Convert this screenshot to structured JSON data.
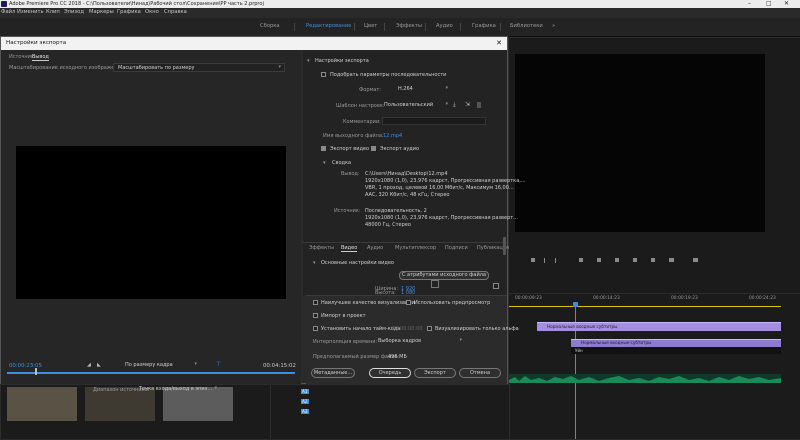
{
  "titlebar": {
    "title": "Adobe Premiere Pro CC 2018 - C:\\Пользователи\\Нинад\\Рабочий стол\\Сохранения\\PP часть 2.prproj",
    "minimize": "–",
    "maximize": "□",
    "close": "✕"
  },
  "menu": [
    "Файл",
    "Изменить",
    "Клип",
    "Эпизод",
    "Маркеры",
    "Графика",
    "Окно",
    "Справка"
  ],
  "workspaces": {
    "items": [
      "Сборка",
      "Редактирование",
      "Цвет",
      "Эффекты",
      "Аудио",
      "Графика",
      "Библиотеки"
    ],
    "active": "Редактирование",
    "more": "»"
  },
  "dialog": {
    "title": "Настройки экспорта",
    "close": "✕",
    "tabs": [
      "Источник",
      "Вывод"
    ],
    "active_tab": "Вывод",
    "source_scaling_label": "Масштабирование исходного изображения:",
    "source_scaling_value": "Масштабировать по размеру",
    "timecode_start": "00:00:23:05",
    "timecode_end": "00:04:15:02",
    "fit_value": "По размеру кадра",
    "range_label": "Диапазон источника:",
    "range_value": "Точка входа/выход в эпиз...",
    "export_settings": {
      "header": "Настройки экспорта",
      "match_seq": "Подобрать параметры последовательности",
      "format_label": "Формат:",
      "format_value": "H.264",
      "preset_label": "Шаблон настроек:",
      "preset_value": "Пользовательский",
      "comments_label": "Комментарии:",
      "comments_value": "",
      "output_name_label": "Имя выходного файла:",
      "output_name_value": "12.mp4",
      "export_video": "Экспорт видео",
      "export_audio": "Экспорт аудио"
    },
    "summary": {
      "header": "Сводка",
      "output_label": "Вывод:",
      "output_lines": [
        "C:\\Users\\Нинад\\Desktop\\12.mp4",
        "1920x1080 (1,0), 23,976 кадрст, Прогрессивная развертка,...",
        "VBR, 1 проход, целевой 16,00 Мбит/с, Максимум 16,00...",
        "AAC, 320 Кбит/с, 48 кГц, Стерео"
      ],
      "source_label": "Источник:",
      "source_lines": [
        "Последовательность, 2",
        "1920x1080 (1,0), 23,976 кадрст, Прогрессивная разверт...",
        "48000 Гц, Стерео"
      ]
    },
    "lower_tabs": [
      "Эффекты",
      "Видео",
      "Аудио",
      "Мультиплексор",
      "Подписи",
      "Публикация"
    ],
    "lower_active": "Видео",
    "video": {
      "header": "Основные настройки видео",
      "match_button": "С атрибутами исходного файла",
      "width_label": "Ширина:",
      "width_value": "1 920",
      "height_label": "Высота:",
      "height_value": "1 080"
    },
    "options": {
      "max_render": "Наилучшее качество визуализации",
      "use_previews": "Использовать предпросмотр",
      "import_project": "Импорт в проект",
      "set_timecode": "Установить начало тайм-кода",
      "timecode_value": "00:00:00:00",
      "render_alpha": "Визуализировать только альфа",
      "interp_label": "Интерполяция времени:",
      "interp_value": "Выборка кадров",
      "size_label": "Предполагаемый размер файла:",
      "size_value": "496 МБ"
    },
    "buttons": {
      "metadata": "Метаданные...",
      "queue": "Очередь",
      "export": "Экспорт",
      "cancel": "Отмена"
    }
  },
  "timeline": {
    "ruler": [
      "00:00:09:23",
      "00:00:14:23",
      "00:00:19:23",
      "00:00:24:23",
      "00:00:34:23"
    ],
    "clips": [
      "Нормальные входные субтитры",
      "Нормальные входные субтитры"
    ],
    "clip_label_small": "Уйн",
    "track_a1": "A1",
    "track_a2": "A2",
    "track_a3": "A3"
  },
  "colors": {
    "accent": "#3f8ee0",
    "clip": "#a58de0",
    "audio": "#1a8a5a",
    "yellow": "#d8c400"
  }
}
